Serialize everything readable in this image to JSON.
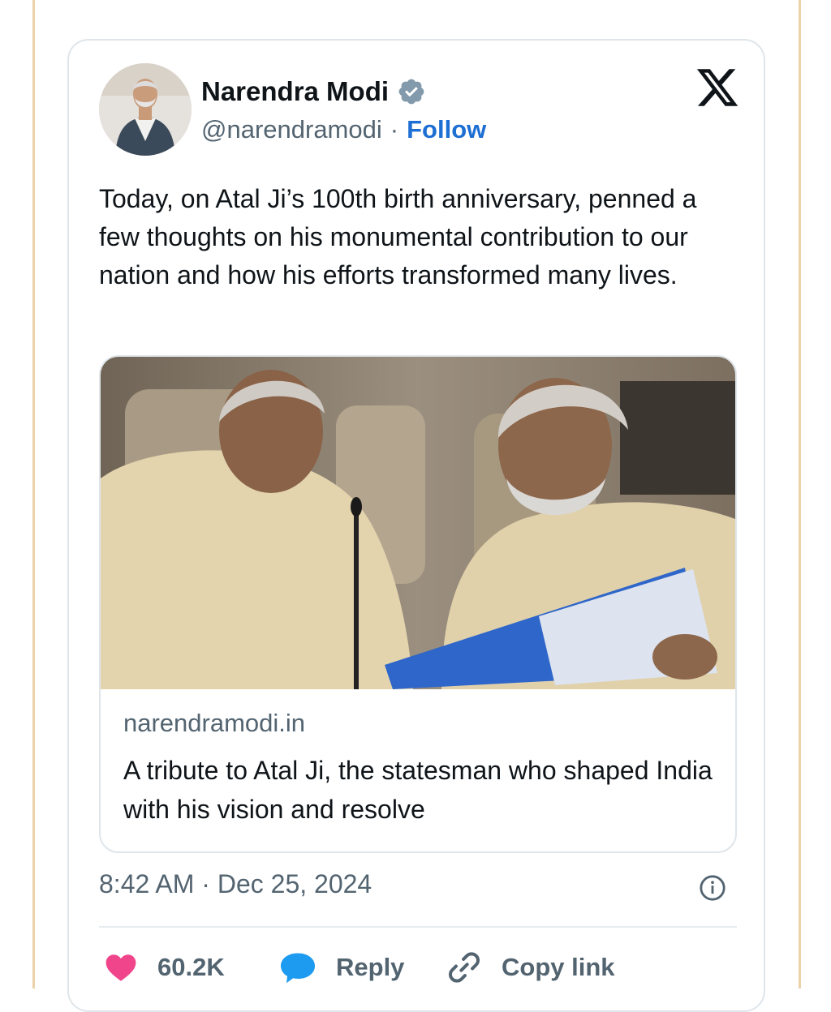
{
  "post": {
    "author_name": "Narendra Modi",
    "handle": "@narendramodi",
    "separator": "·",
    "follow_label": "Follow",
    "text": "Today, on Atal Ji’s 100th birth anniversary, penned a few thoughts on his monumental contribution to our nation and how his efforts transformed many lives.",
    "link_card": {
      "domain": "narendramodi.in",
      "title": "A tribute to Atal Ji, the statesman who shaped India with his vision and resolve"
    },
    "timestamp": "8:42 AM · Dec 25, 2024",
    "actions": {
      "likes": "60.2K",
      "reply_label": "Reply",
      "copy_link_label": "Copy link"
    }
  },
  "icons": {
    "platform": "x-logo-icon",
    "verified": "verified-badge-icon",
    "info": "info-icon",
    "like": "heart-icon",
    "reply": "speech-bubble-icon",
    "copy_link": "link-icon"
  },
  "colors": {
    "accent_blue": "#1d6fd3",
    "like_pink": "#f0458b",
    "reply_blue": "#1d9bf0",
    "muted_text": "#536471",
    "verified_gray": "#829aab"
  }
}
